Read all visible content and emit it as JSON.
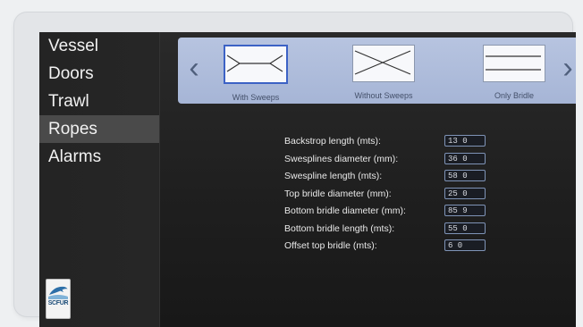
{
  "sidebar": {
    "items": [
      {
        "label": "Vessel"
      },
      {
        "label": "Doors"
      },
      {
        "label": "Trawl"
      },
      {
        "label": "Ropes"
      },
      {
        "label": "Alarms"
      }
    ],
    "active_index": 3,
    "logo_text": "SCFUR"
  },
  "selector": {
    "prev_icon": "chevron-left-icon",
    "next_icon": "chevron-right-icon",
    "options": [
      {
        "label": "With Sweeps",
        "selected": true
      },
      {
        "label": "Without Sweeps",
        "selected": false
      },
      {
        "label": "Only Bridle",
        "selected": false
      }
    ]
  },
  "params": [
    {
      "label": "Backstrop length (mts):",
      "value": "13 0"
    },
    {
      "label": "Swesplines diameter (mm):",
      "value": "36 0"
    },
    {
      "label": "Swespline length (mts):",
      "value": "58 0"
    },
    {
      "label": "Top bridle diameter (mm):",
      "value": "25 0"
    },
    {
      "label": "Bottom bridle diameter (mm):",
      "value": "85 9"
    },
    {
      "label": "Bottom bridle length (mts):",
      "value": "55 0"
    },
    {
      "label": "Offset top bridle (mts):",
      "value": "6 0"
    }
  ],
  "colors": {
    "accent": "#3c62c5",
    "selector_bg": "#b0bddb",
    "active_nav": "#4a4a4a"
  }
}
